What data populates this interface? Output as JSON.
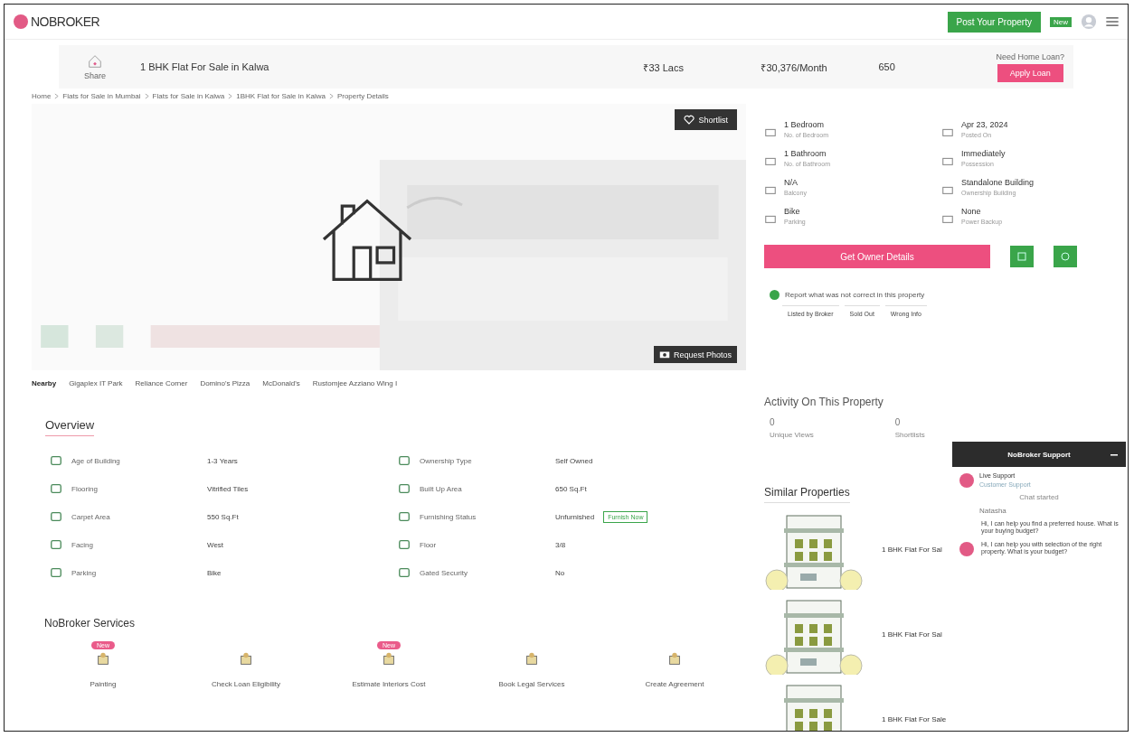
{
  "header": {
    "logo": "NOBROKER",
    "post_button": "Post Your Property",
    "new_badge": "New"
  },
  "listing": {
    "share_label": "Share",
    "title": "1 BHK Flat For Sale in Kalwa",
    "price": "₹33 Lacs",
    "emi": "₹30,376/Month",
    "area": "650",
    "loan_label": "Need Home Loan?",
    "loan_button": "Apply Loan"
  },
  "breadcrumb": [
    "Home",
    "Flats for Sale in Mumbai",
    "Flats for Sale in Kalwa",
    "1BHK Flat for Sale in Kalwa",
    "Property Details"
  ],
  "gallery": {
    "shortlist": "Shortlist",
    "request_photos": "Request Photos"
  },
  "nearby": [
    {
      "label": "Nearby",
      "selected": true
    },
    {
      "label": "Gigaplex IT Park",
      "selected": false
    },
    {
      "label": "Reliance Corner",
      "selected": false
    },
    {
      "label": "Domino's Pizza",
      "selected": false
    },
    {
      "label": "McDonald's",
      "selected": false
    },
    {
      "label": "Rustomjee Azziano Wing I",
      "selected": false
    }
  ],
  "details": [
    {
      "value": "1 Bedroom",
      "label": "No. of Bedroom"
    },
    {
      "value": "Apr 23, 2024",
      "label": "Posted On"
    },
    {
      "value": "1 Bathroom",
      "label": "No. of Bathroom"
    },
    {
      "value": "Immediately",
      "label": "Possession"
    },
    {
      "value": "N/A",
      "label": "Balcony"
    },
    {
      "value": "Standalone Building",
      "label": "Ownership Building"
    },
    {
      "value": "Bike",
      "label": "Parking"
    },
    {
      "value": "None",
      "label": "Power Backup"
    }
  ],
  "owner_button": "Get Owner Details",
  "report": {
    "text": "Report what was not correct in this property",
    "options": [
      "Listed by Broker",
      "Sold Out",
      "Wrong Info"
    ]
  },
  "overview": {
    "title": "Overview",
    "rows": [
      {
        "label": "Age of Building",
        "value": "1-3 Years"
      },
      {
        "label": "Ownership Type",
        "value": "Self Owned"
      },
      {
        "label": "Flooring",
        "value": "Vitrified Tiles"
      },
      {
        "label": "Built Up Area",
        "value": "650 Sq.Ft"
      },
      {
        "label": "Carpet Area",
        "value": "550 Sq.Ft"
      },
      {
        "label": "Furnishing Status",
        "value": "Unfurnished",
        "action": "Furnish Now"
      },
      {
        "label": "Facing",
        "value": "West"
      },
      {
        "label": "Floor",
        "value": "3/8"
      },
      {
        "label": "Parking",
        "value": "Bike"
      },
      {
        "label": "Gated Security",
        "value": "No"
      }
    ]
  },
  "services": {
    "title": "NoBroker Services",
    "items": [
      {
        "label": "Painting",
        "badge": "New"
      },
      {
        "label": "Check Loan Eligibility"
      },
      {
        "label": "Estimate Interiors Cost",
        "badge": "New"
      },
      {
        "label": "Book Legal Services"
      },
      {
        "label": "Create Agreement"
      }
    ]
  },
  "activity": {
    "title": "Activity On This Property",
    "stats": [
      {
        "count": "0",
        "label": "Unique Views"
      },
      {
        "count": "0",
        "label": "Shortlists"
      }
    ]
  },
  "similar": {
    "title": "Similar Properties",
    "items": [
      {
        "title": "1 BHK Flat For Sal"
      },
      {
        "title": "1 BHK Flat For Sal"
      },
      {
        "title": "1 BHK Flat For Sale"
      }
    ]
  },
  "chat": {
    "title": "NoBroker Support",
    "agent": "Live Support",
    "role": "Customer Support",
    "status": "Chat started",
    "agent_name": "Natasha",
    "messages": [
      "Hi, I can help you find a preferred house. What is your buying budget?",
      "Hi, I can help you with selection of the right property. What is your budget?"
    ]
  }
}
